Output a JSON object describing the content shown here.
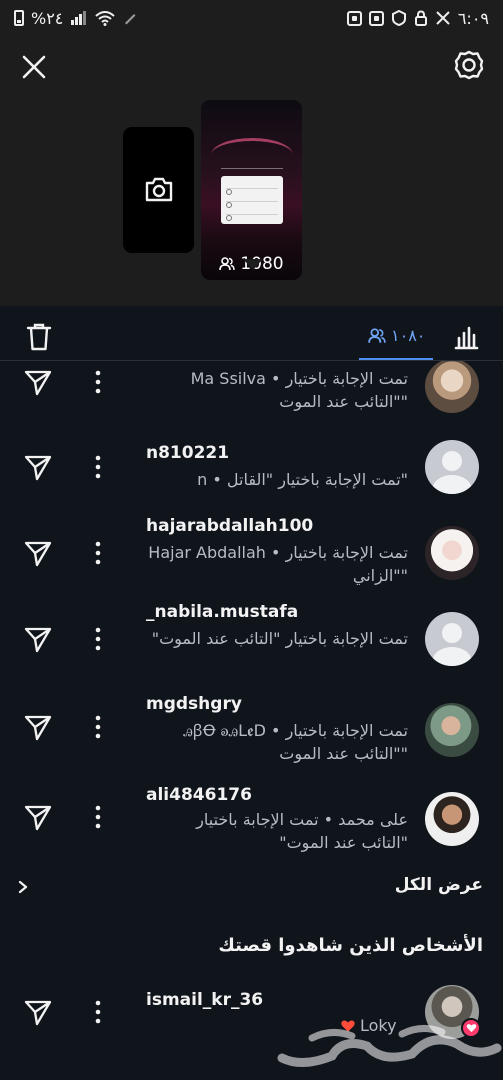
{
  "status_bar": {
    "battery": "%٢٤",
    "time": "٦:٠٩"
  },
  "story": {
    "viewer_count": "1080"
  },
  "tabs": {
    "viewers_count": "١٠٨٠"
  },
  "viewers": [
    {
      "username": "",
      "description": "Ma Ssilva • تمت الإجابة باختيار \"التائب عند الموت\"",
      "avatar": "photo"
    },
    {
      "username": "n810221",
      "description": "n • تمت الإجابة باختيار \"القاتل\"",
      "avatar": "default"
    },
    {
      "username": "hajarabdallah100",
      "description": "Hajar Abdallah • تمت الإجابة باختيار \"الزاني\"",
      "avatar": "photo"
    },
    {
      "username": "_nabila.mustafa",
      "description": "تمت الإجابة باختيار \"التائب عند الموت\"",
      "avatar": "default"
    },
    {
      "username": "mgdshgry",
      "description": "ꭿꞵꝊ ꭷꭿLꬲD • تمت الإجابة باختيار \"التائب عند الموت\"",
      "avatar": "photo"
    },
    {
      "username": "ali4846176",
      "description": "على محمد • تمت الإجابة باختيار \"التائب عند الموت\"",
      "avatar": "photo"
    }
  ],
  "see_all_label": "عرض الكل",
  "section_title": "الأشخاص الذين شاهدوا قصتك",
  "story_viewer": {
    "username": "ismail_kr_36",
    "reaction_name": "Loky"
  },
  "colors": {
    "background": "#10151c",
    "header": "#1d1d1d",
    "accent": "#4e8ff0",
    "heart": "#ff3b6d"
  },
  "icons": [
    "close-icon",
    "settings-icon",
    "camera-icon",
    "trash-icon",
    "viewers-icon",
    "stats-icon",
    "send-icon",
    "more-icon",
    "chevron-right-icon",
    "heart-icon"
  ]
}
